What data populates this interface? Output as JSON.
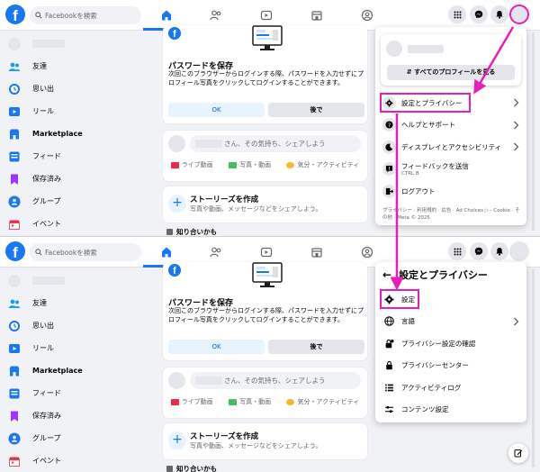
{
  "search": {
    "placeholder": "Facebookを検索"
  },
  "leftnav": [
    {
      "label": "友達",
      "icon": "friends-icon"
    },
    {
      "label": "思い出",
      "icon": "memories-icon"
    },
    {
      "label": "リール",
      "icon": "reels-icon"
    },
    {
      "label": "Marketplace",
      "icon": "marketplace-icon"
    },
    {
      "label": "フィード",
      "icon": "feed-icon"
    },
    {
      "label": "保存済み",
      "icon": "saved-icon"
    },
    {
      "label": "グループ",
      "icon": "groups-icon"
    },
    {
      "label": "イベント",
      "icon": "events-icon"
    }
  ],
  "password_card": {
    "title": "パスワードを保存",
    "body": "次回このブラウザーからログインする際、パスワードを入力せずにプロフィール写真をクリックしてログインすることができます。",
    "ok_label": "OK",
    "later_label": "後で"
  },
  "composer": {
    "prompt": "さん、その気持ち、シェアしよう",
    "actions": [
      "ライブ動画",
      "写真・動画",
      "気分・アクティビティ"
    ]
  },
  "stories": {
    "title": "ストーリーズを作成",
    "subtitle": "写真や動画、メッセージなどをシェアしよう。"
  },
  "people_you_may_know": "知り合いかも",
  "account_menu": {
    "see_all_profiles": "すべてのプロフィールを見る",
    "items": [
      {
        "label": "設定とプライバシー",
        "icon": "gear-icon",
        "chevron": true
      },
      {
        "label": "ヘルプとサポート",
        "icon": "help-icon",
        "chevron": true
      },
      {
        "label": "ディスプレイとアクセシビリティ",
        "icon": "moon-icon",
        "chevron": true
      },
      {
        "label": "フィードバックを送信",
        "sub": "CTRL B",
        "icon": "feedback-icon",
        "chevron": false
      },
      {
        "label": "ログアウト",
        "icon": "logout-icon",
        "chevron": false
      }
    ],
    "footer": "プライバシー · 利用規約 · 広告 · Ad Choices ▷ · Cookie · その他 · Meta © 2025"
  },
  "settings_menu": {
    "title": "設定とプライバシー",
    "items": [
      {
        "label": "設定",
        "icon": "gear-icon",
        "chevron": false
      },
      {
        "label": "言語",
        "icon": "globe-icon",
        "chevron": true
      },
      {
        "label": "プライバシー設定の確認",
        "icon": "lock-check-icon",
        "chevron": false
      },
      {
        "label": "プライバシーセンター",
        "icon": "lock-icon",
        "chevron": false
      },
      {
        "label": "アクティビティログ",
        "icon": "list-icon",
        "chevron": false
      },
      {
        "label": "コンテンツ設定",
        "icon": "sliders-icon",
        "chevron": false
      }
    ]
  },
  "colors": {
    "brand": "#1877f2",
    "highlight": "#e91eba",
    "background": "#f0f2f5"
  }
}
